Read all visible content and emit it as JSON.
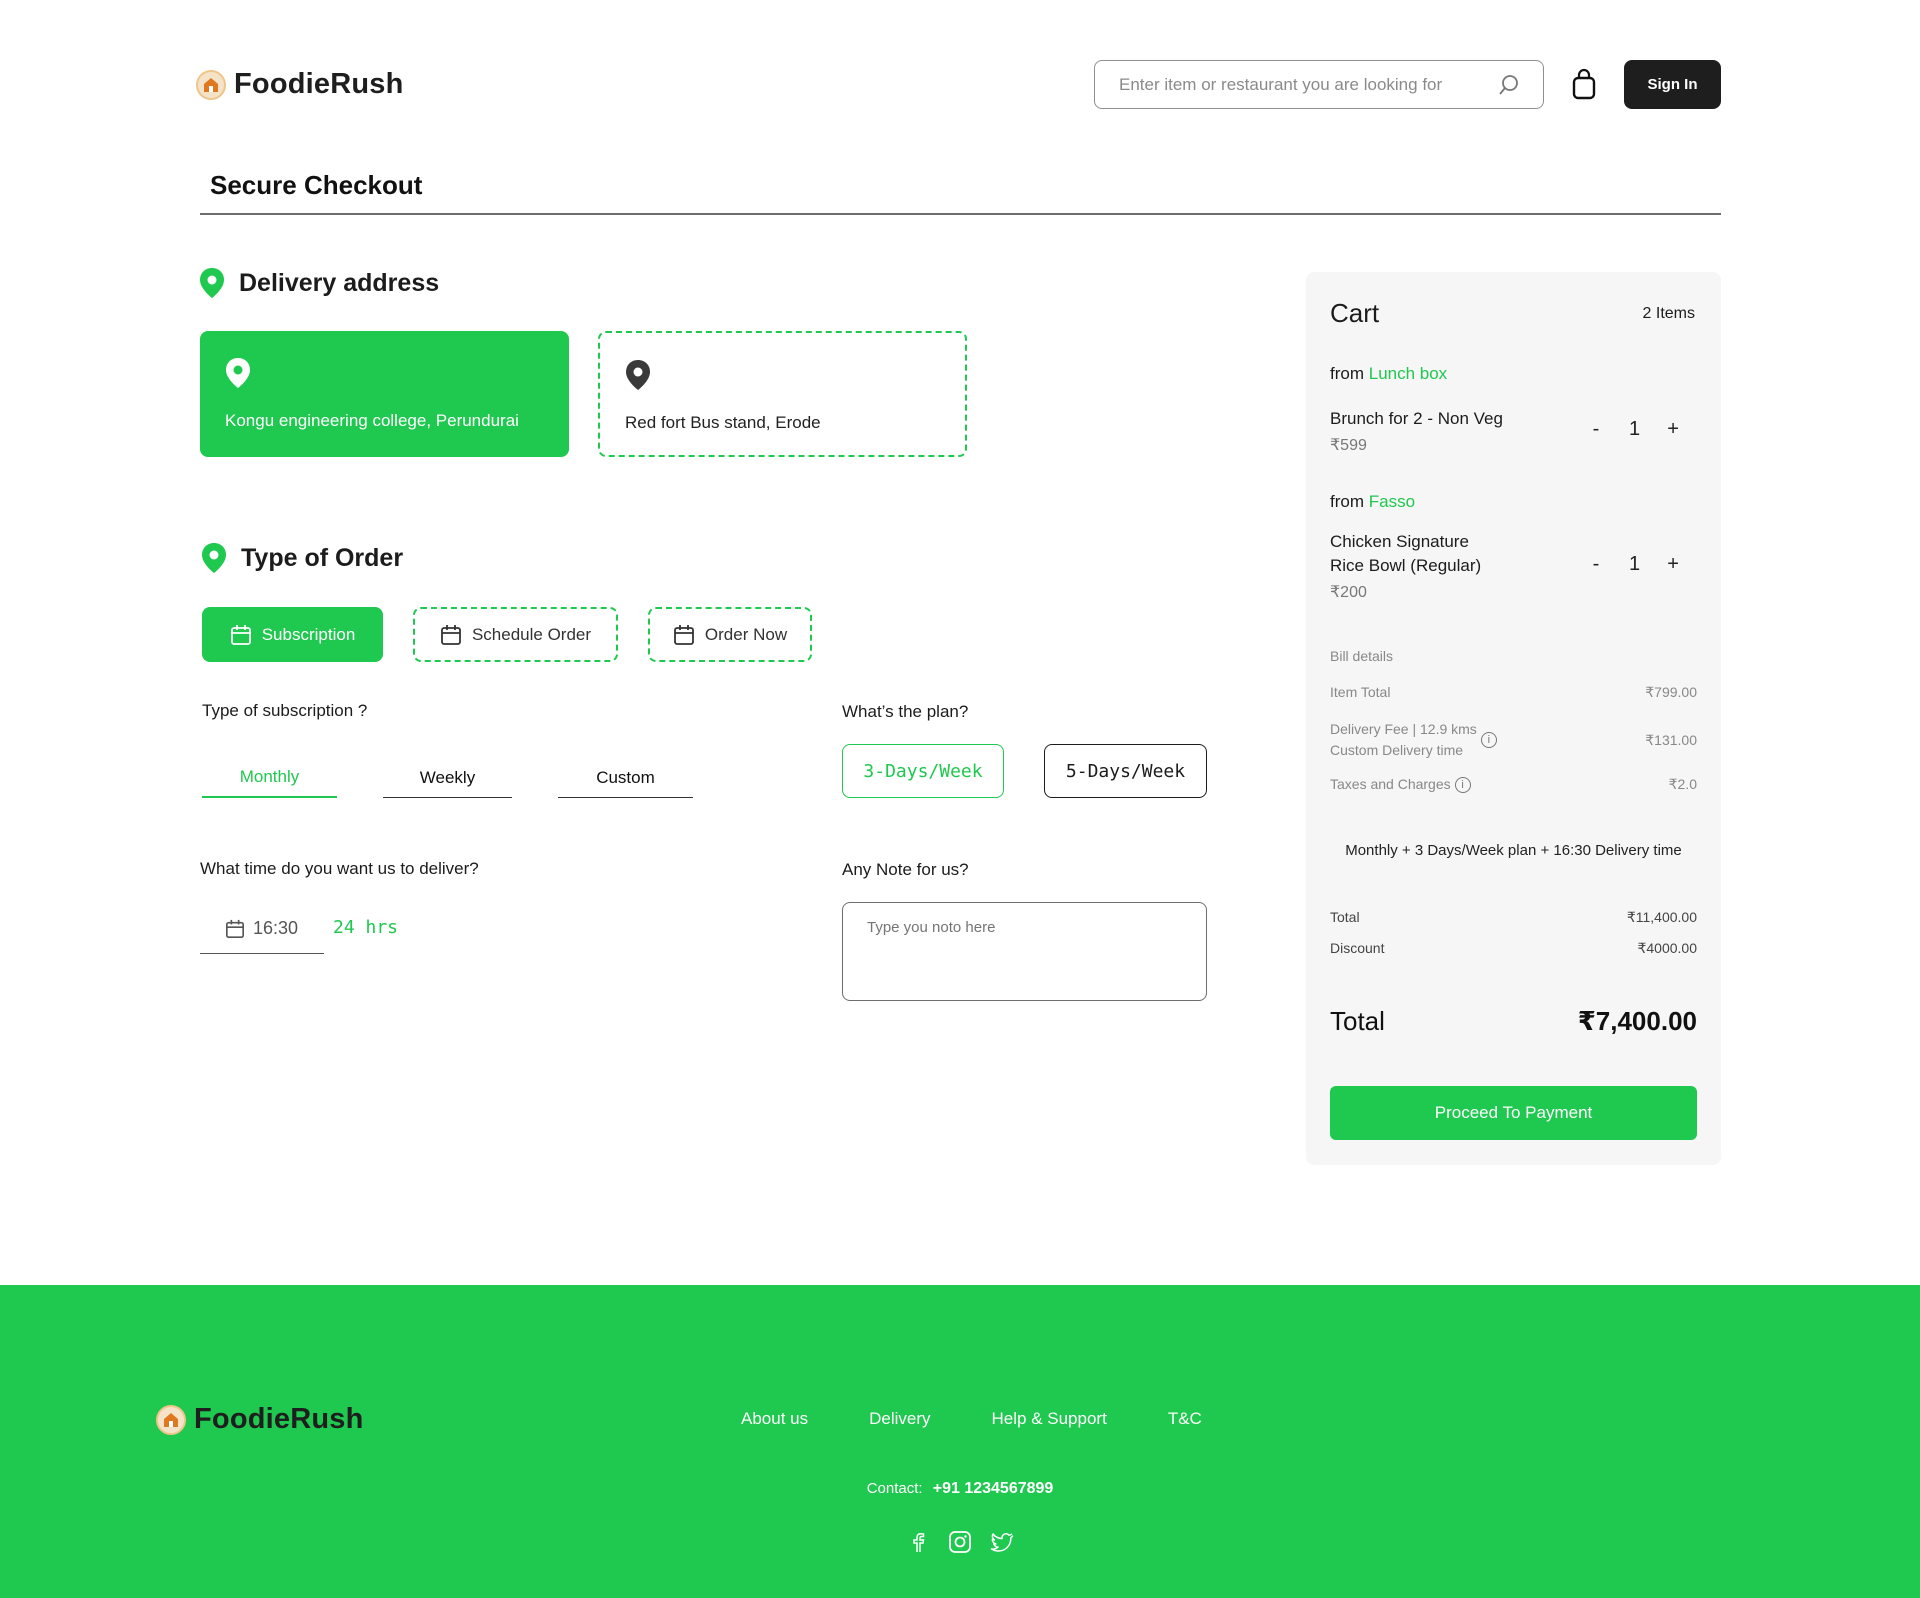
{
  "header": {
    "brand": "FoodieRush",
    "search_placeholder": "Enter item or restaurant you are looking for",
    "signin_label": "Sign In"
  },
  "page_title": "Secure Checkout",
  "delivery": {
    "heading": "Delivery address",
    "addresses": [
      {
        "label": "Kongu engineering college, Perundurai",
        "selected": true
      },
      {
        "label": "Red fort Bus stand, Erode",
        "selected": false
      }
    ]
  },
  "order_type": {
    "heading": "Type of Order",
    "options": [
      {
        "label": "Subscription",
        "active": true
      },
      {
        "label": "Schedule Order",
        "active": false
      },
      {
        "label": "Order Now",
        "active": false
      }
    ]
  },
  "subscription": {
    "question": "Type of subscription ?",
    "tabs": [
      {
        "label": "Monthly",
        "active": true
      },
      {
        "label": "Weekly",
        "active": false
      },
      {
        "label": "Custom",
        "active": false
      }
    ]
  },
  "plan": {
    "question": "What’s the plan?",
    "options": [
      {
        "label": "3-Days/Week",
        "active": true
      },
      {
        "label": "5-Days/Week",
        "active": false
      }
    ]
  },
  "delivery_time": {
    "question": "What time do you want us to deliver?",
    "value": "16:30",
    "format": "24 hrs"
  },
  "note": {
    "question": "Any Note for us?",
    "placeholder": "Type you noto here"
  },
  "cart": {
    "title": "Cart",
    "count": "2 Items",
    "groups": [
      {
        "from": "from",
        "restaurant": "Lunch box",
        "item_line1": "Brunch for 2 - Non Veg",
        "item_line2": "",
        "price": "₹599",
        "qty": "1"
      },
      {
        "from": "from",
        "restaurant": "Fasso",
        "item_line1": "Chicken  Signature",
        "item_line2": "Rice Bowl (Regular)",
        "price": "₹200",
        "qty": "1"
      }
    ],
    "bill_heading": "Bill details",
    "bill": [
      {
        "label": "Item Total",
        "label2": "",
        "value": "₹799.00"
      },
      {
        "label": "Delivery Fee | 12.9 kms",
        "label2": "Custom Delivery time",
        "value": "₹131.00"
      },
      {
        "label": "Taxes and Charges",
        "label2": "",
        "value": "₹2.0"
      }
    ],
    "plan_summary": "Monthly + 3 Days/Week plan +  16:30 Delivery time",
    "total_label": "Total",
    "total_value": "₹11,400.00",
    "discount_label": "Discount",
    "discount_value": "₹4000.00",
    "grand_label": "Total",
    "grand_value": "₹7,400.00",
    "pay_label": "Proceed To Payment",
    "minus": "-",
    "plus": "+"
  },
  "footer": {
    "brand": "FoodieRush",
    "links": [
      "About us",
      "Delivery",
      "Help & Support",
      "T&C"
    ],
    "contact_label": "Contact:",
    "contact_value": "+91 1234567899"
  },
  "colors": {
    "accent": "#1fc84f",
    "dark": "#1e1e1e",
    "cart_bg": "#f6f6f6"
  },
  "icons": [
    "logo-icon",
    "search-icon",
    "bag-icon",
    "location-pin-icon",
    "calendar-icon",
    "info-icon",
    "facebook-icon",
    "instagram-icon",
    "twitter-icon"
  ]
}
